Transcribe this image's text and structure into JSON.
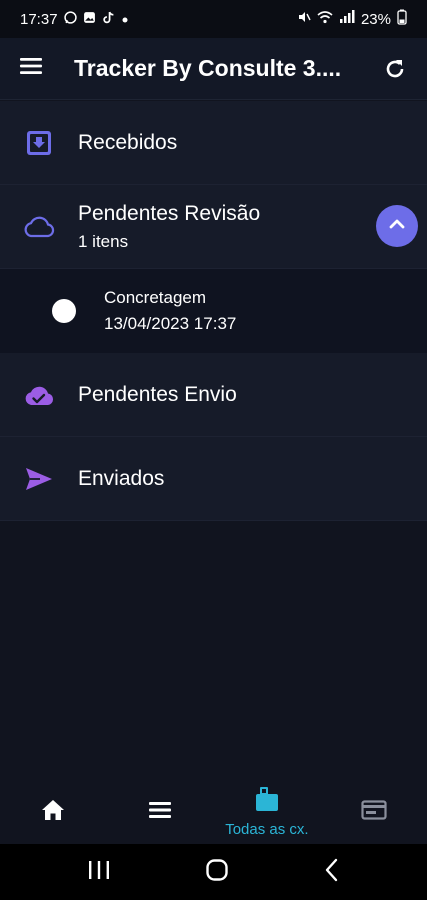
{
  "status_bar": {
    "time": "17:37",
    "battery": "23%"
  },
  "app_bar": {
    "title": "Tracker By Consulte 3...."
  },
  "list": {
    "received": {
      "label": "Recebidos"
    },
    "pending_review": {
      "label": "Pendentes Revisão",
      "count": "1 itens"
    },
    "pending_item": {
      "name": "Concretagem",
      "datetime": "13/04/2023 17:37"
    },
    "pending_send": {
      "label": "Pendentes Envio"
    },
    "sent": {
      "label": "Enviados"
    }
  },
  "bottom_nav": {
    "active_label": "Todas as cx."
  },
  "colors": {
    "accent": "#6d6de8",
    "purple_icon": "#9b5de5",
    "active_tab": "#2bb5d6"
  }
}
